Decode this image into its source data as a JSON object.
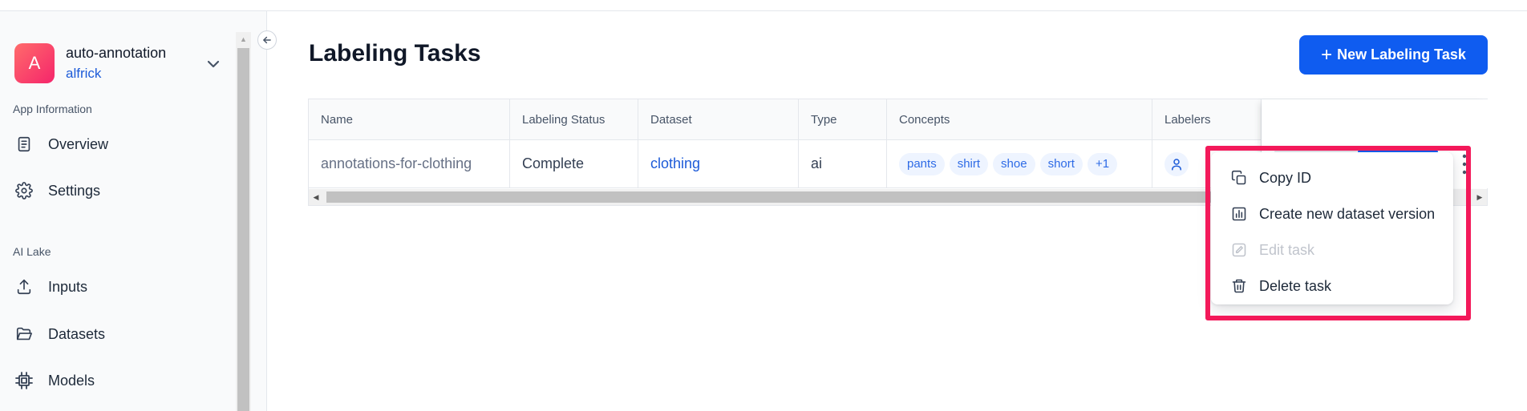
{
  "sidebar": {
    "app": {
      "initial": "A",
      "name": "auto-annotation",
      "user": "alfrick"
    },
    "sections": [
      {
        "label": "App Information"
      },
      {
        "label": "AI Lake"
      }
    ],
    "items": [
      {
        "label": "Overview",
        "icon": "document-icon"
      },
      {
        "label": "Settings",
        "icon": "gear-icon"
      },
      {
        "label": "Inputs",
        "icon": "upload-icon"
      },
      {
        "label": "Datasets",
        "icon": "folder-open-icon"
      },
      {
        "label": "Models",
        "icon": "cpu-chip-icon"
      }
    ]
  },
  "main": {
    "title": "Labeling Tasks",
    "new_button": {
      "plus": "+",
      "label": "New Labeling Task"
    },
    "table": {
      "headers": [
        "Name",
        "Labeling Status",
        "Dataset",
        "Type",
        "Concepts",
        "Labelers"
      ],
      "rows": [
        {
          "name": "annotations-for-clothing",
          "status": "Complete",
          "dataset": "clothing",
          "type": "ai",
          "concepts": [
            "pants",
            "shirt",
            "shoe",
            "short",
            "+1"
          ]
        }
      ]
    }
  },
  "menu": {
    "items": [
      {
        "label": "Copy ID",
        "icon": "copy-icon",
        "disabled": false
      },
      {
        "label": "Create new dataset version",
        "icon": "bar-chart-icon",
        "disabled": false
      },
      {
        "label": "Edit task",
        "icon": "edit-icon",
        "disabled": true
      },
      {
        "label": "Delete task",
        "icon": "trash-icon",
        "disabled": false
      }
    ]
  },
  "colors": {
    "accent": "#0f5cf0",
    "link": "#1d5bd8",
    "highlight": "#f3195a",
    "avatar": "#f5256b"
  }
}
